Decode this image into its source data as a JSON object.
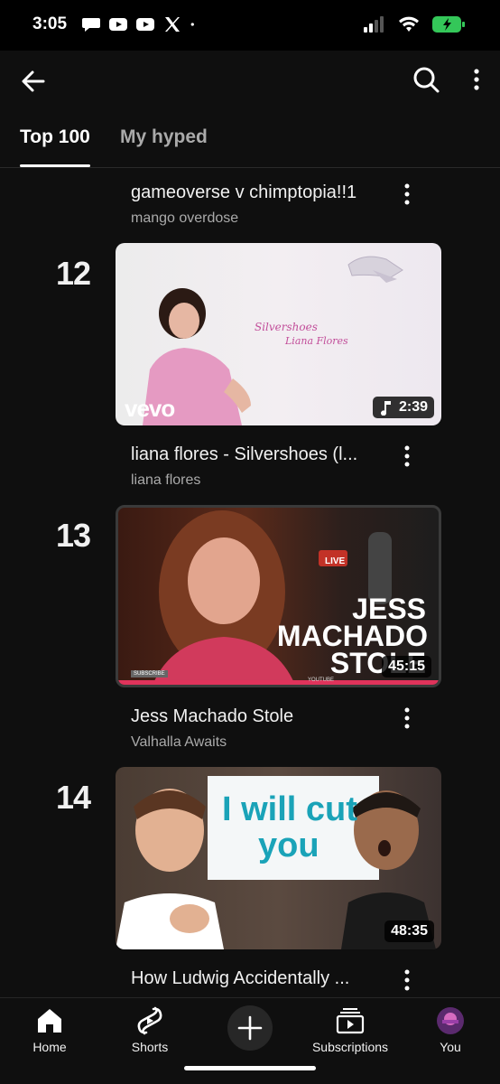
{
  "status": {
    "time": "3:05",
    "left_icons": [
      "chat-bubble-icon",
      "youtube-icon",
      "youtube-icon",
      "x-logo-icon",
      "dot-icon"
    ],
    "right_icons": [
      "cell-signal-icon",
      "wifi-icon",
      "battery-charging-icon"
    ],
    "battery_color": "#34c759"
  },
  "topbar": {
    "back_icon": "arrow-left-icon",
    "search_icon": "search-icon",
    "menu_icon": "more-vert-icon"
  },
  "tabs": [
    {
      "label": "Top 100",
      "active": true
    },
    {
      "label": "My hyped",
      "active": false
    }
  ],
  "items": [
    {
      "title": "gameoverse v chimptopia!!1",
      "channel": "mango overdose"
    },
    {
      "rank": "12",
      "title": "liana flores - Silvershoes (l...",
      "channel": "liana flores",
      "duration": "2:39",
      "music": true,
      "thumb_text": {
        "logo": "vevo",
        "script1": "Silvershoes",
        "script2": "Liana Flores"
      }
    },
    {
      "rank": "13",
      "title": "Jess Machado Stole",
      "channel": "Valhalla Awaits",
      "duration": "45:15",
      "thumb_text": {
        "line1": "JESS",
        "line2": "MACHADO",
        "line3": "STOLE",
        "live": "LIVE",
        "footer": "YOUTUBE",
        "subscribe": "SUBSCRIBE"
      }
    },
    {
      "rank": "14",
      "title": "How Ludwig Accidentally ...",
      "duration": "48:35",
      "thumb_text": {
        "line1": "I will cut",
        "line2": "you"
      }
    }
  ],
  "bottomnav": [
    {
      "label": "Home",
      "icon": "home-icon"
    },
    {
      "label": "Shorts",
      "icon": "shorts-icon"
    },
    {
      "label": "",
      "icon": "plus-icon"
    },
    {
      "label": "Subscriptions",
      "icon": "subscriptions-icon"
    },
    {
      "label": "You",
      "icon": "avatar"
    }
  ],
  "colors": {
    "background": "#0f0f0f",
    "text_primary": "#f1f1f1",
    "text_secondary": "#aaaaaa",
    "accent_teal": "#1aa3b8"
  }
}
